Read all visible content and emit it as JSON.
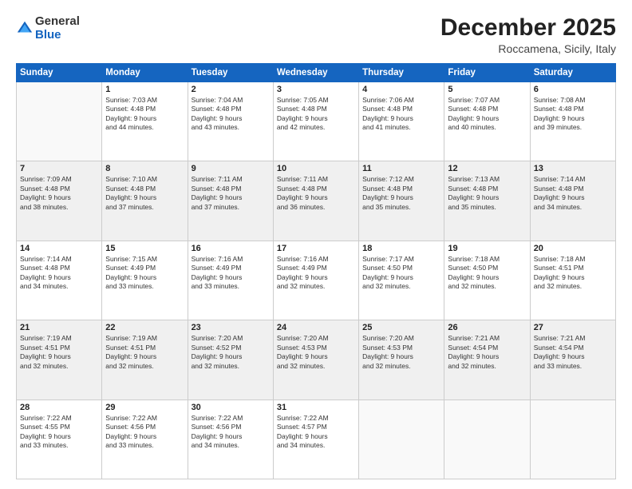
{
  "logo": {
    "general": "General",
    "blue": "Blue"
  },
  "title": "December 2025",
  "location": "Roccamena, Sicily, Italy",
  "days_header": [
    "Sunday",
    "Monday",
    "Tuesday",
    "Wednesday",
    "Thursday",
    "Friday",
    "Saturday"
  ],
  "weeks": [
    [
      {
        "num": "",
        "info": ""
      },
      {
        "num": "1",
        "info": "Sunrise: 7:03 AM\nSunset: 4:48 PM\nDaylight: 9 hours\nand 44 minutes."
      },
      {
        "num": "2",
        "info": "Sunrise: 7:04 AM\nSunset: 4:48 PM\nDaylight: 9 hours\nand 43 minutes."
      },
      {
        "num": "3",
        "info": "Sunrise: 7:05 AM\nSunset: 4:48 PM\nDaylight: 9 hours\nand 42 minutes."
      },
      {
        "num": "4",
        "info": "Sunrise: 7:06 AM\nSunset: 4:48 PM\nDaylight: 9 hours\nand 41 minutes."
      },
      {
        "num": "5",
        "info": "Sunrise: 7:07 AM\nSunset: 4:48 PM\nDaylight: 9 hours\nand 40 minutes."
      },
      {
        "num": "6",
        "info": "Sunrise: 7:08 AM\nSunset: 4:48 PM\nDaylight: 9 hours\nand 39 minutes."
      }
    ],
    [
      {
        "num": "7",
        "info": "Sunrise: 7:09 AM\nSunset: 4:48 PM\nDaylight: 9 hours\nand 38 minutes."
      },
      {
        "num": "8",
        "info": "Sunrise: 7:10 AM\nSunset: 4:48 PM\nDaylight: 9 hours\nand 37 minutes."
      },
      {
        "num": "9",
        "info": "Sunrise: 7:11 AM\nSunset: 4:48 PM\nDaylight: 9 hours\nand 37 minutes."
      },
      {
        "num": "10",
        "info": "Sunrise: 7:11 AM\nSunset: 4:48 PM\nDaylight: 9 hours\nand 36 minutes."
      },
      {
        "num": "11",
        "info": "Sunrise: 7:12 AM\nSunset: 4:48 PM\nDaylight: 9 hours\nand 35 minutes."
      },
      {
        "num": "12",
        "info": "Sunrise: 7:13 AM\nSunset: 4:48 PM\nDaylight: 9 hours\nand 35 minutes."
      },
      {
        "num": "13",
        "info": "Sunrise: 7:14 AM\nSunset: 4:48 PM\nDaylight: 9 hours\nand 34 minutes."
      }
    ],
    [
      {
        "num": "14",
        "info": "Sunrise: 7:14 AM\nSunset: 4:48 PM\nDaylight: 9 hours\nand 34 minutes."
      },
      {
        "num": "15",
        "info": "Sunrise: 7:15 AM\nSunset: 4:49 PM\nDaylight: 9 hours\nand 33 minutes."
      },
      {
        "num": "16",
        "info": "Sunrise: 7:16 AM\nSunset: 4:49 PM\nDaylight: 9 hours\nand 33 minutes."
      },
      {
        "num": "17",
        "info": "Sunrise: 7:16 AM\nSunset: 4:49 PM\nDaylight: 9 hours\nand 32 minutes."
      },
      {
        "num": "18",
        "info": "Sunrise: 7:17 AM\nSunset: 4:50 PM\nDaylight: 9 hours\nand 32 minutes."
      },
      {
        "num": "19",
        "info": "Sunrise: 7:18 AM\nSunset: 4:50 PM\nDaylight: 9 hours\nand 32 minutes."
      },
      {
        "num": "20",
        "info": "Sunrise: 7:18 AM\nSunset: 4:51 PM\nDaylight: 9 hours\nand 32 minutes."
      }
    ],
    [
      {
        "num": "21",
        "info": "Sunrise: 7:19 AM\nSunset: 4:51 PM\nDaylight: 9 hours\nand 32 minutes."
      },
      {
        "num": "22",
        "info": "Sunrise: 7:19 AM\nSunset: 4:51 PM\nDaylight: 9 hours\nand 32 minutes."
      },
      {
        "num": "23",
        "info": "Sunrise: 7:20 AM\nSunset: 4:52 PM\nDaylight: 9 hours\nand 32 minutes."
      },
      {
        "num": "24",
        "info": "Sunrise: 7:20 AM\nSunset: 4:53 PM\nDaylight: 9 hours\nand 32 minutes."
      },
      {
        "num": "25",
        "info": "Sunrise: 7:20 AM\nSunset: 4:53 PM\nDaylight: 9 hours\nand 32 minutes."
      },
      {
        "num": "26",
        "info": "Sunrise: 7:21 AM\nSunset: 4:54 PM\nDaylight: 9 hours\nand 32 minutes."
      },
      {
        "num": "27",
        "info": "Sunrise: 7:21 AM\nSunset: 4:54 PM\nDaylight: 9 hours\nand 33 minutes."
      }
    ],
    [
      {
        "num": "28",
        "info": "Sunrise: 7:22 AM\nSunset: 4:55 PM\nDaylight: 9 hours\nand 33 minutes."
      },
      {
        "num": "29",
        "info": "Sunrise: 7:22 AM\nSunset: 4:56 PM\nDaylight: 9 hours\nand 33 minutes."
      },
      {
        "num": "30",
        "info": "Sunrise: 7:22 AM\nSunset: 4:56 PM\nDaylight: 9 hours\nand 34 minutes."
      },
      {
        "num": "31",
        "info": "Sunrise: 7:22 AM\nSunset: 4:57 PM\nDaylight: 9 hours\nand 34 minutes."
      },
      {
        "num": "",
        "info": ""
      },
      {
        "num": "",
        "info": ""
      },
      {
        "num": "",
        "info": ""
      }
    ]
  ]
}
